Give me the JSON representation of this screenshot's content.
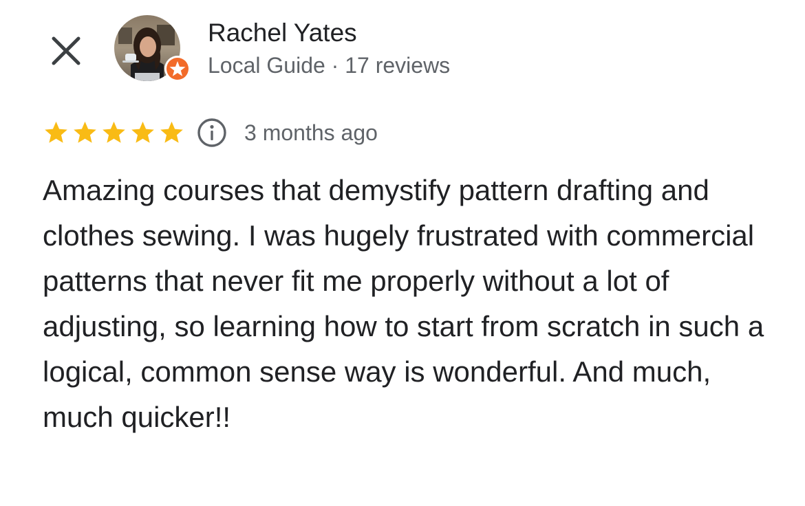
{
  "colors": {
    "star": "#F9BB15",
    "badge": "#F26B2A",
    "text_primary": "#202124",
    "text_secondary": "#5f6368"
  },
  "header": {
    "close_icon": "close-icon",
    "avatar_icon": "avatar-photo",
    "badge_icon": "local-guide-star-icon",
    "name": "Rachel Yates",
    "meta": "Local Guide · 17 reviews"
  },
  "review": {
    "rating": 5,
    "rating_max": 5,
    "info_icon": "info-icon",
    "date": "3 months ago",
    "text": "Amazing courses that demystify pattern drafting and clothes sewing. I was hugely frustrated with commercial patterns that never fit me properly without a lot of adjusting, so learning how to start from scratch in such a logical, common sense way is wonderful. And much, much quicker!!"
  }
}
